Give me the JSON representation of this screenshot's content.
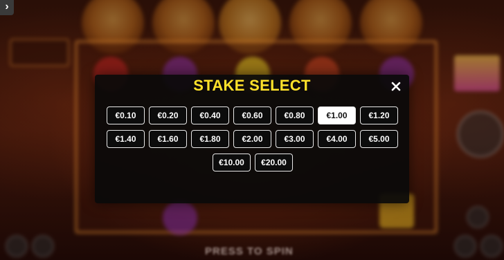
{
  "modal": {
    "title": "STAKE SELECT",
    "close_icon": "close-icon",
    "selected": "€1.00",
    "stakes_row1": [
      "€0.10",
      "€0.20",
      "€0.40",
      "€0.60",
      "€0.80",
      "€1.00",
      "€1.20"
    ],
    "stakes_row2": [
      "€1.40",
      "€1.60",
      "€1.80",
      "€2.00",
      "€3.00",
      "€4.00",
      "€5.00"
    ],
    "stakes_row3": [
      "€10.00",
      "€20.00"
    ]
  },
  "background": {
    "press_to_spin": "PRESS TO SPIN",
    "back_icon": "chevron-right-icon"
  },
  "colors": {
    "title": "#ffe22a",
    "selected_bg": "#ffffff",
    "button_border": "#e8e8e8",
    "modal_bg": "#0a0a0a"
  }
}
